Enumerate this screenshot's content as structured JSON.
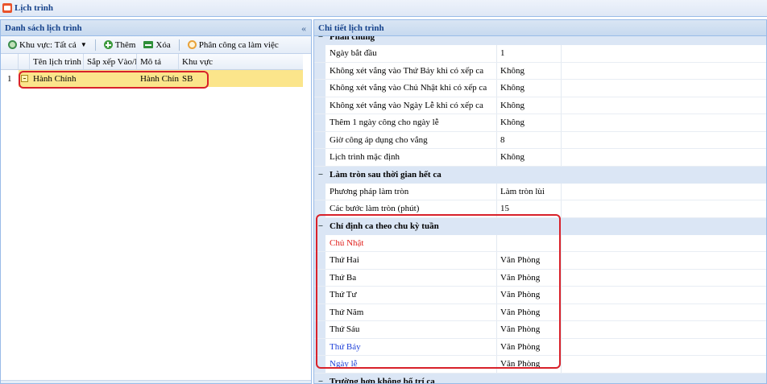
{
  "window": {
    "title": "Lịch trình"
  },
  "left_panel": {
    "title": "Danh sách lịch trình",
    "collapse_glyph": "«",
    "toolbar": {
      "region_label": "Khu vực: Tất cả",
      "add_label": "Thêm",
      "delete_label": "Xóa",
      "assign_label": "Phân công ca làm việc"
    },
    "columns": [
      "Tên lịch trình",
      "Sắp xếp Vào/Ra",
      "Mô tả",
      "Khu vực"
    ],
    "rows": [
      {
        "index": "1",
        "name": "Hành Chính",
        "sort": "",
        "description": "Hành Chính",
        "region": "SB"
      }
    ]
  },
  "right_panel": {
    "title": "Chi tiết lịch trình",
    "sections": [
      {
        "title": "Phần chung",
        "toggle": "−",
        "rows": [
          {
            "name": "Ngày bắt đầu",
            "value": "1"
          },
          {
            "name": "Không xét vắng vào Thứ Bảy khi có xếp ca",
            "value": "Không"
          },
          {
            "name": "Không xét vắng vào Chủ Nhật khi có xếp ca",
            "value": "Không"
          },
          {
            "name": "Không xét vắng vào Ngày Lễ khi có xếp ca",
            "value": "Không"
          },
          {
            "name": "Thêm 1 ngày công cho ngày lễ",
            "value": "Không"
          },
          {
            "name": "Giờ công áp dụng cho vắng",
            "value": "8"
          },
          {
            "name": "Lịch trình mặc định",
            "value": "Không"
          }
        ]
      },
      {
        "title": "Làm tròn sau thời gian hết ca",
        "toggle": "−",
        "rows": [
          {
            "name": "Phương pháp làm tròn",
            "value": "Làm tròn lùi"
          },
          {
            "name": "Các bước làm tròn (phút)",
            "value": "15"
          }
        ]
      },
      {
        "title": "Chỉ định ca theo chu kỳ tuần",
        "toggle": "−",
        "rows": [
          {
            "name": "Chủ Nhật",
            "value": "",
            "color": "#e0201c"
          },
          {
            "name": "Thứ Hai",
            "value": "Văn Phòng"
          },
          {
            "name": "Thứ Ba",
            "value": "Văn Phòng"
          },
          {
            "name": "Thứ Tư",
            "value": "Văn Phòng"
          },
          {
            "name": "Thứ Năm",
            "value": "Văn Phòng"
          },
          {
            "name": "Thứ Sáu",
            "value": "Văn Phòng"
          },
          {
            "name": "Thứ Bảy",
            "value": "Văn Phòng",
            "color": "#1d3fd8"
          },
          {
            "name": "Ngày lễ",
            "value": "Văn Phòng",
            "color": "#1d3fd8"
          }
        ]
      },
      {
        "title": "Trường hợp không bố trí ca",
        "toggle": "−",
        "rows": []
      }
    ]
  }
}
